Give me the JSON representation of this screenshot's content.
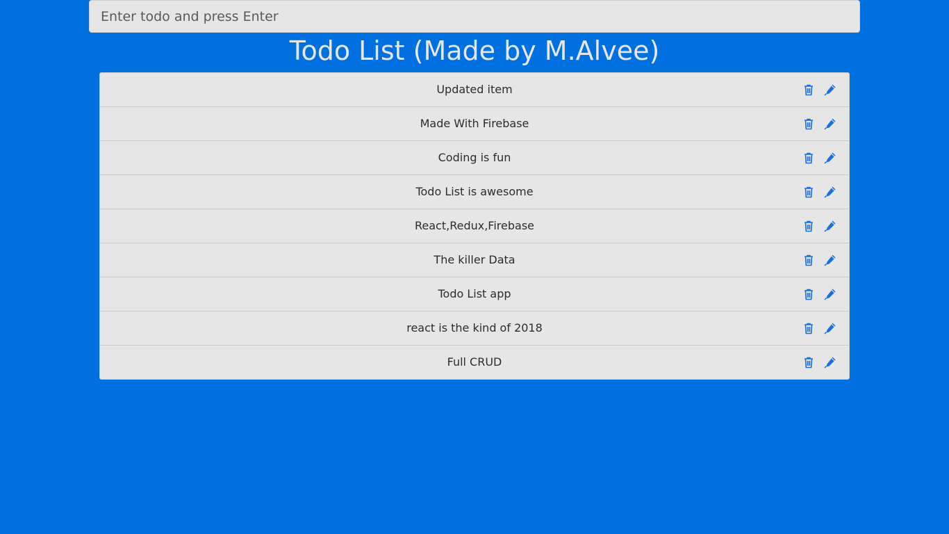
{
  "input": {
    "placeholder": "Enter todo and press Enter",
    "value": ""
  },
  "title": "Todo List (Made by M.Alvee)",
  "todos": [
    {
      "text": "Updated item"
    },
    {
      "text": "Made With Firebase"
    },
    {
      "text": "Coding is fun"
    },
    {
      "text": "Todo List is awesome"
    },
    {
      "text": "React,Redux,Firebase"
    },
    {
      "text": "The killer Data"
    },
    {
      "text": "Todo List app"
    },
    {
      "text": "react is the kind of 2018"
    },
    {
      "text": "Full CRUD"
    }
  ],
  "icons": {
    "delete": "trash-icon",
    "edit": "pencil-icon"
  },
  "colors": {
    "background": "#006fe0",
    "panel": "#e6e6e6",
    "icon": "#1a6fd8",
    "title": "#e6e6e6"
  }
}
